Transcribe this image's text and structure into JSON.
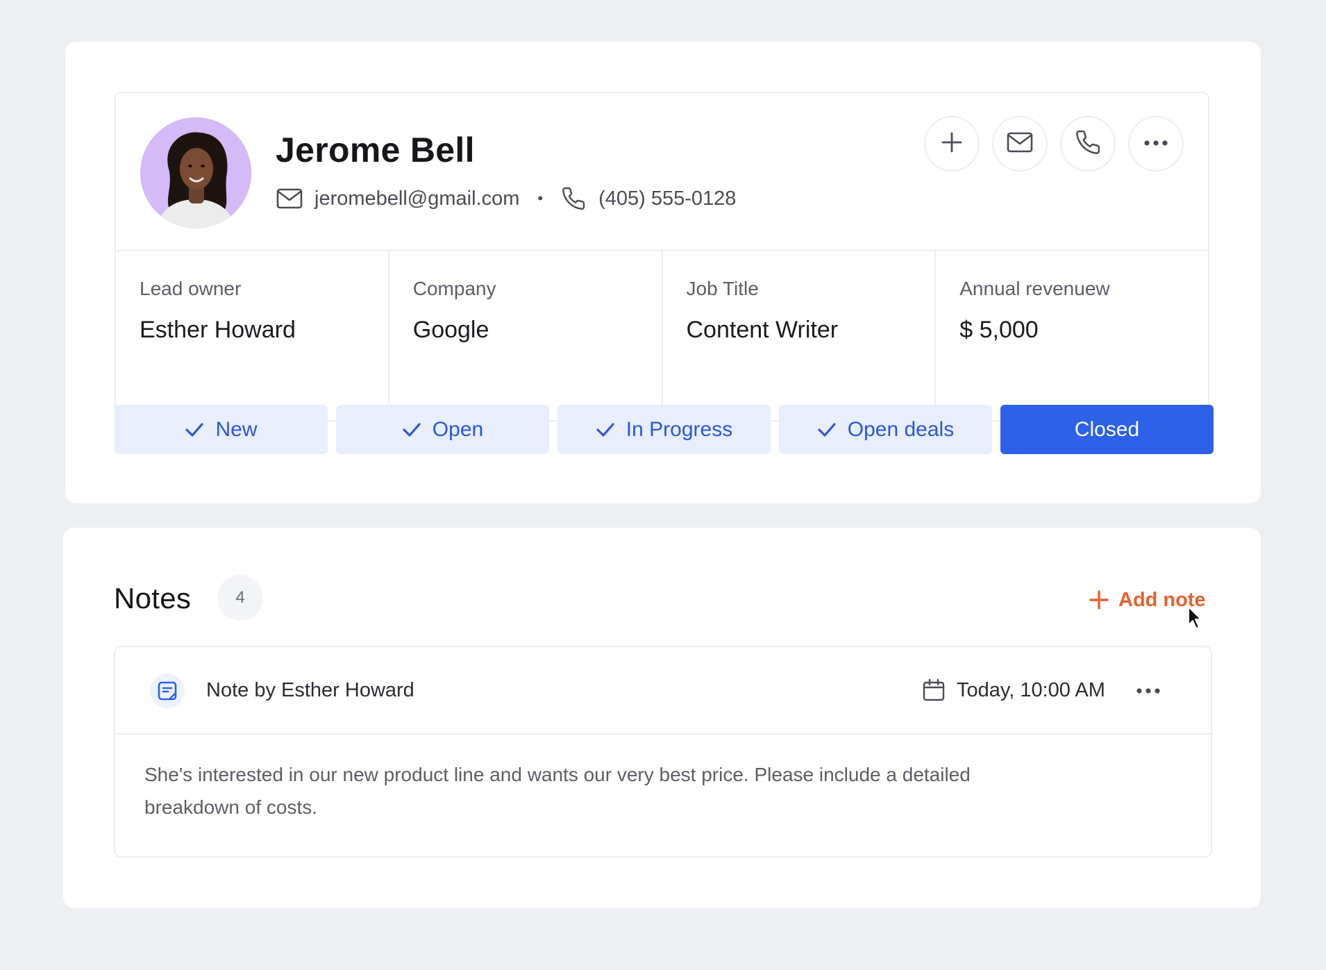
{
  "contact": {
    "name": "Jerome Bell",
    "email": "jeromebell@gmail.com",
    "separator": "•",
    "phone": "(405) 555-0128",
    "avatar_bg": "#d4baf6"
  },
  "actions": [
    {
      "icon": "plus-icon"
    },
    {
      "icon": "mail-icon"
    },
    {
      "icon": "phone-icon"
    },
    {
      "icon": "more-horizontal-icon"
    }
  ],
  "stats": [
    {
      "label": "Lead owner",
      "value": "Esther Howard"
    },
    {
      "label": "Company",
      "value": "Google"
    },
    {
      "label": "Job Title",
      "value": "Content Writer"
    },
    {
      "label": "Annual revenuew",
      "value": "$ 5,000"
    }
  ],
  "statuses": [
    {
      "label": "New",
      "done": true
    },
    {
      "label": "Open",
      "done": true
    },
    {
      "label": "In Progress",
      "done": true
    },
    {
      "label": "Open deals",
      "done": true
    },
    {
      "label": "Closed",
      "done": false,
      "active": true
    }
  ],
  "notes": {
    "title": "Notes",
    "count": "4",
    "add_label": "Add note",
    "items": [
      {
        "author": "Note by Esther Howard",
        "date": "Today, 10:00 AM",
        "body": "She's interested in our new product line and wants our very best price. Please include a detailed breakdown of costs."
      }
    ]
  },
  "colors": {
    "accent_blue": "#2c61e8",
    "status_bg": "#e8eefc",
    "add_note_orange": "#e8612f"
  }
}
